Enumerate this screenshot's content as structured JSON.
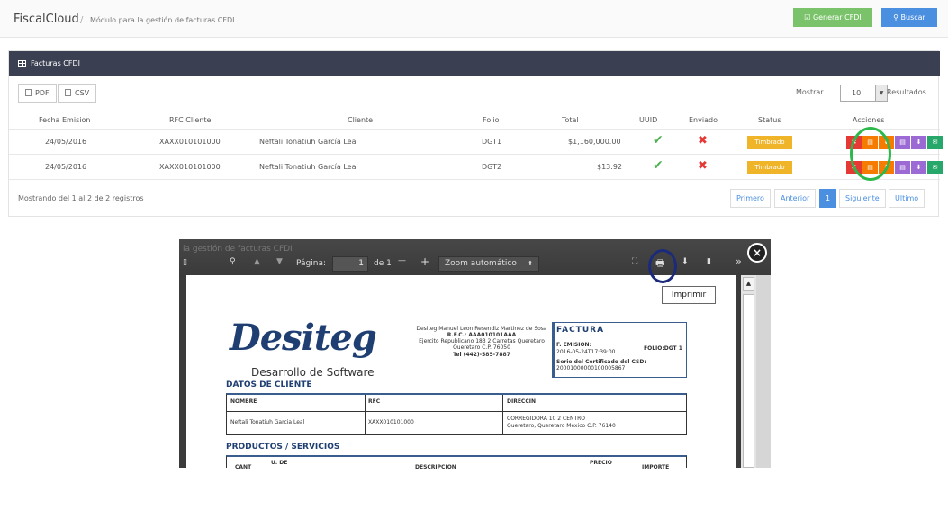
{
  "app": {
    "brand": "FiscalCloud",
    "separator": "/",
    "subtitle": "Módulo para la gestión de facturas CFDI"
  },
  "header_buttons": {
    "generate": "Generar CFDI",
    "search": "Buscar"
  },
  "panel": {
    "title": "Facturas CFDI",
    "export": {
      "pdf": "PDF",
      "csv": "CSV"
    },
    "page_size": {
      "label": "Mostrar",
      "value": "10",
      "suffix": "Resultados"
    },
    "columns": [
      "Fecha Emision",
      "RFC Cliente",
      "Cliente",
      "Folio",
      "Total",
      "UUID",
      "Enviado",
      "Status",
      "Acciones"
    ],
    "rows": [
      {
        "fecha": "24/05/2016",
        "rfc": "XAXX010101000",
        "cliente": "Neftali Tonatiuh García Leal",
        "folio": "DGT1",
        "total": "$1,160,000.00",
        "status": "Timbrado"
      },
      {
        "fecha": "24/05/2016",
        "rfc": "XAXX010101000",
        "cliente": "Neftali Tonatiuh García Leal",
        "folio": "DGT2",
        "total": "$13.92",
        "status": "Timbrado"
      }
    ],
    "footer": "Mostrando del 1 al 2 de 2 registros",
    "pagination": {
      "first": "Primero",
      "prev": "Anterior",
      "current": "1",
      "next": "Siguiente",
      "last": "Ultimo"
    }
  },
  "viewer": {
    "ghost": "la gestión de facturas CFDI",
    "page_label": "Página:",
    "page_value": "1",
    "page_of": "de 1",
    "zoom": "Zoom automático",
    "tooltip": "Imprimir"
  },
  "invoice": {
    "logo": "Desiteg",
    "logo_sub": "Desarrollo de Software",
    "issuer": [
      "Desiteg Manuel Leon Resendiz Martinez de Sosa",
      "R.F.C.: AAA010101AAA",
      "Ejercito Republicano 183 2 Carretas Queretaro",
      "Queretaro C.P. 76050",
      "Tel (442)-585-7887"
    ],
    "factura": "FACTURA",
    "f_emision_label": "F. EMISION:",
    "f_emision": "2016-05-24T17:39:00",
    "folio_label": "FOLIO:DGT 1",
    "serie_label": "Serie del Certificado del CSD:",
    "serie": "20001000000100005867",
    "client_section": "DATOS DE CLIENTE",
    "client_headers": [
      "NOMBRE",
      "RFC",
      "DIRECCIN"
    ],
    "client_values": [
      "Neftali Tonatiuh Garcia Leal",
      "XAXX010101000",
      "CORREGIDORA 10 2 CENTRO",
      "Queretaro, Queretaro Mexico C.P. 76140"
    ],
    "products_section": "PRODUCTOS / SERVICIOS",
    "products_headers": [
      "CANT",
      "U. DE",
      "DESCRIPCION",
      "PRECIO",
      "IMPORTE"
    ]
  },
  "colors": {
    "header_dark": "#3a3f51",
    "btn_green": "#7bc36b",
    "btn_blue": "#4a8fe0",
    "badge": "#f0b429",
    "check": "#4caf50",
    "cross": "#e53935",
    "circle_green": "#2db84b",
    "circle_blue": "#1b2a7a"
  }
}
